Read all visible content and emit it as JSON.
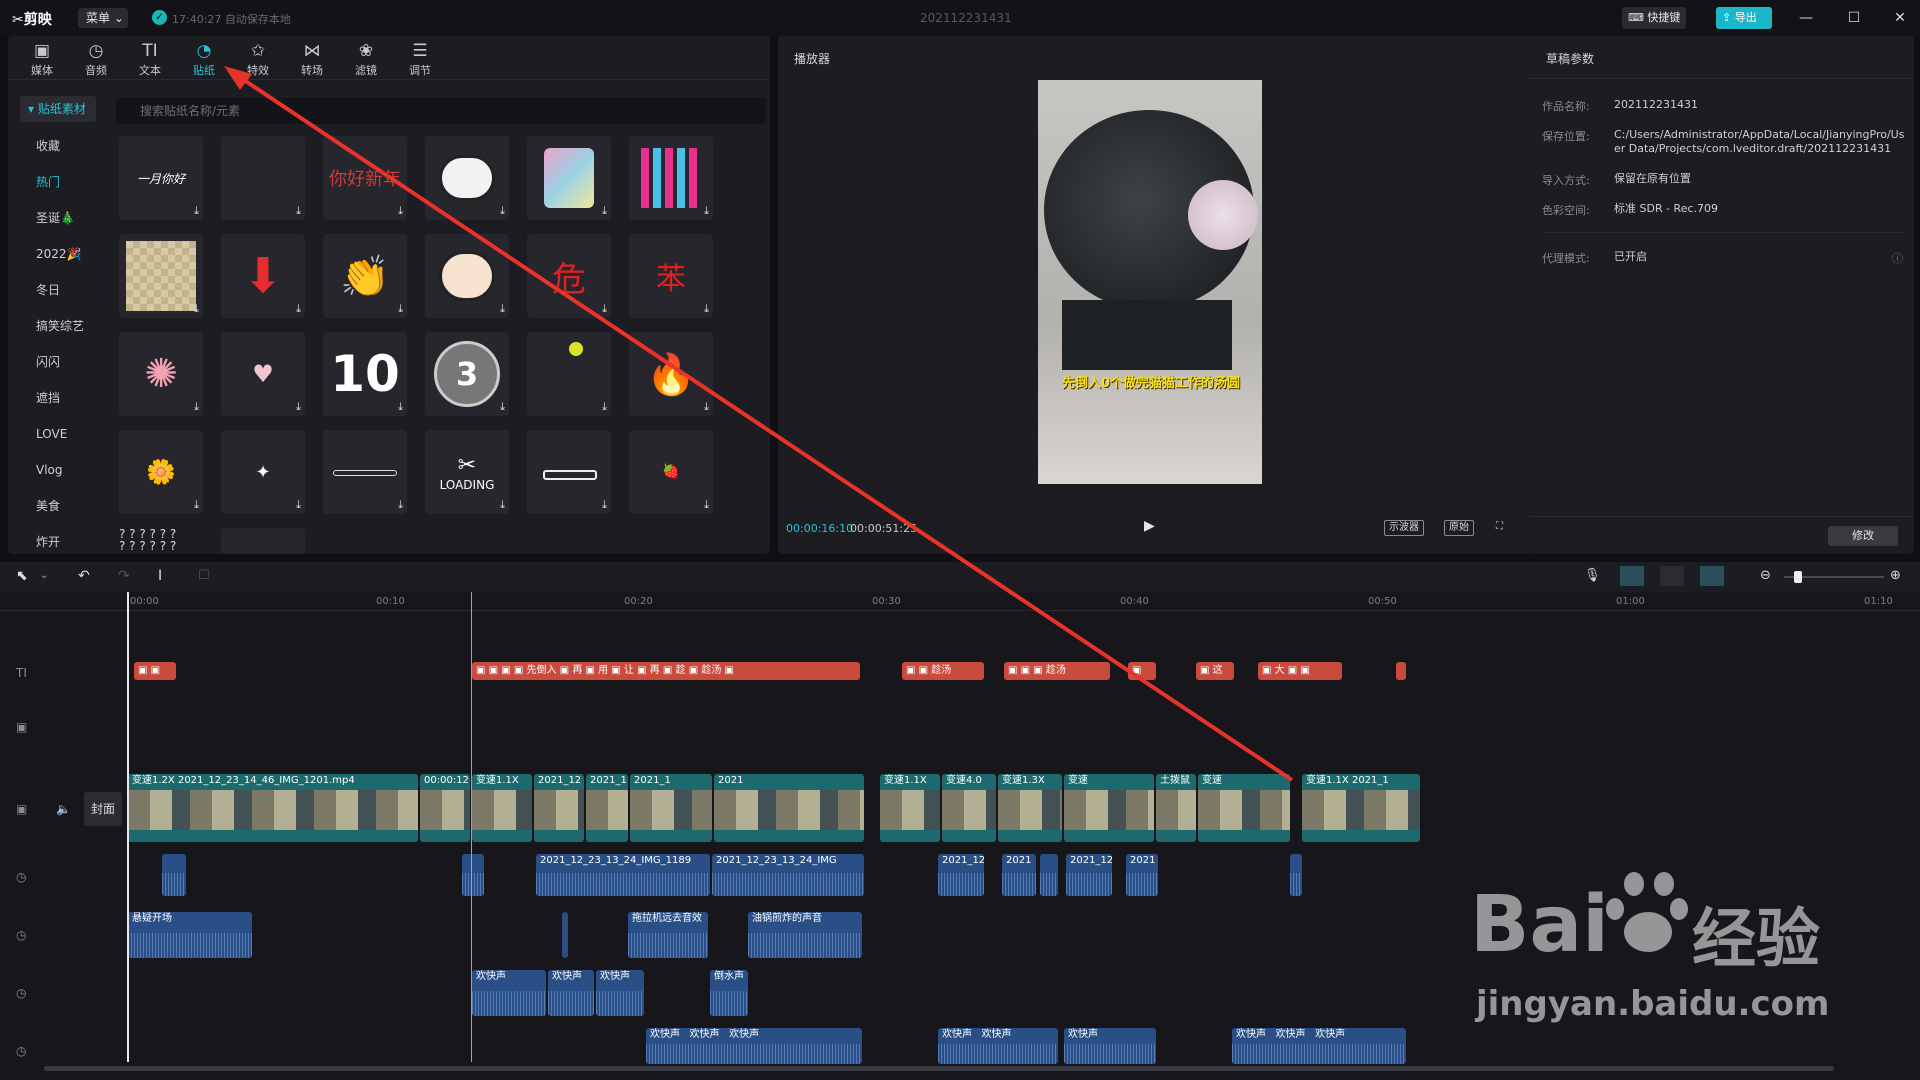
{
  "titlebar": {
    "logo": "剪映",
    "menu": "菜单",
    "save_status": "17:40:27 自动保存本地",
    "window_title": "202112231431",
    "shortcut": "快捷键",
    "export": "导出"
  },
  "toolbar": {
    "tabs": [
      {
        "icon": "media-icon",
        "label": "媒体"
      },
      {
        "icon": "audio-icon",
        "label": "音频"
      },
      {
        "icon": "text-icon",
        "label": "文本"
      },
      {
        "icon": "sticker-icon",
        "label": "贴纸"
      },
      {
        "icon": "effects-icon",
        "label": "特效"
      },
      {
        "icon": "transition-icon",
        "label": "转场"
      },
      {
        "icon": "filter-icon",
        "label": "滤镜"
      },
      {
        "icon": "adjust-icon",
        "label": "调节"
      }
    ],
    "active": "贴纸"
  },
  "sticker_panel": {
    "header": "贴纸素材",
    "search_placeholder": "搜索贴纸名称/元素",
    "categories": [
      "收藏",
      "热门",
      "圣诞🎄",
      "2022🎉",
      "冬日",
      "搞笑综艺",
      "闪闪",
      "遮挡",
      "LOVE",
      "Vlog",
      "美食",
      "炸开"
    ],
    "selected_category": "热门",
    "stickers": [
      "一月你好",
      "",
      "你好新年",
      "panda",
      "badge",
      "2021 lights",
      "mosaic",
      "down-arrow",
      "clap-hand",
      "cartoon-boy",
      "危",
      "苯",
      "sparkle-burst",
      "hearts",
      "10",
      "3",
      "ball",
      "fire",
      "flower",
      "sparkle",
      "LOADING bar",
      "LOADING",
      "slider",
      "LOADING strawberry",
      "? ? ? ? ? ?",
      "loading-bar"
    ],
    "sticker_texts": {
      "loading": "LOADING",
      "qmarks": "? ? ? ? ? ?\n? ? ? ? ? ?"
    }
  },
  "player": {
    "title": "播放器",
    "subtitle": "先倒入0个做完猫猫工作的汤圆",
    "time_current": "00:00:16:10",
    "time_total": "00:00:51:25",
    "btn_scope": "示波器",
    "btn_original": "原始"
  },
  "props": {
    "title": "草稿参数",
    "fields": [
      {
        "label": "作品名称:",
        "value": "202112231431"
      },
      {
        "label": "保存位置:",
        "value": "C:/Users/Administrator/AppData/Local/JianyingPro/User Data/Projects/com.lveditor.draft/202112231431"
      },
      {
        "label": "导入方式:",
        "value": "保留在原有位置"
      },
      {
        "label": "色彩空间:",
        "value": "标准 SDR - Rec.709"
      },
      {
        "label": "代理模式:",
        "value": "已开启"
      }
    ],
    "modify": "修改"
  },
  "timeline": {
    "ruler": [
      "00:00",
      "00:10",
      "00:20",
      "00:30",
      "00:40",
      "00:50",
      "01:00",
      "01:10"
    ],
    "cover": "封面",
    "video_clips": [
      "变速1.2X",
      "2021_12_23_14_46_IMG_1201.mp4",
      "00:00:12",
      "变速1.1X",
      "2021_12",
      "2021_1",
      "2021_1",
      "2021",
      "变速4.0",
      "变速1.3X",
      "变速",
      "土拨鼠",
      "变速1.1X",
      "2021_1"
    ],
    "audio_clips_row1": [
      "2021_12_23_13_24_IMG_1189",
      "2021_12_23_13_24_IMG",
      "2021",
      "2021_12",
      "2021",
      "2021_12",
      "2021"
    ],
    "audio_clips_row2": [
      "悬疑开场",
      "拖拉机远去音效",
      "油锅煎炸的声音"
    ],
    "audio_clips_row3": [
      "欢快声",
      "欢快声",
      "欢快声",
      "倒水声"
    ],
    "audio_clips_row4": [
      "欢快声",
      "欢快声",
      "欢快声",
      "欢快声",
      "欢快声",
      "欢快声",
      "欢快声",
      "欢快声",
      "欢快声",
      "欢快声"
    ]
  },
  "watermark": {
    "brand": "Bai",
    "suffix": "经验",
    "url": "jingyan.baidu.com"
  }
}
